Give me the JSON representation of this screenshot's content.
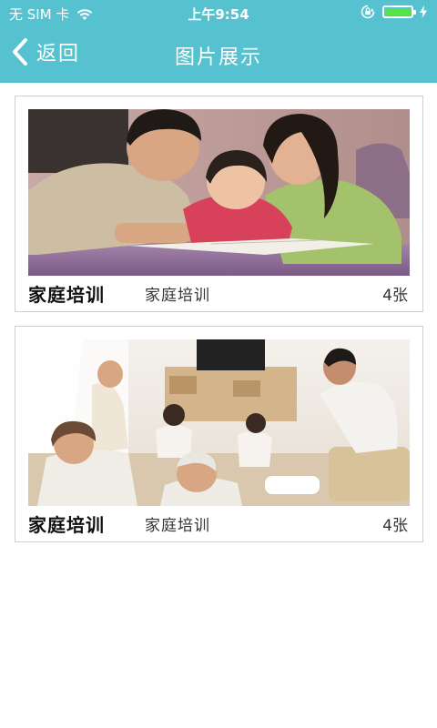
{
  "status_bar": {
    "carrier": "无 SIM 卡",
    "time": "上午9:54"
  },
  "nav": {
    "back_label": "返回",
    "title": "图片展示"
  },
  "colors": {
    "header": "#56c2cf",
    "battery": "#57e24a"
  },
  "cards": [
    {
      "title": "家庭培训",
      "subtitle": "家庭培训",
      "count": "4张",
      "image": "family-reading-photo"
    },
    {
      "title": "家庭培训",
      "subtitle": "家庭培训",
      "count": "4张",
      "image": "family-living-room-photo"
    }
  ]
}
